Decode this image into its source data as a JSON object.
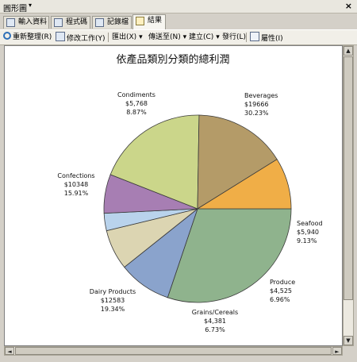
{
  "window": {
    "title": "圓形圖",
    "close_glyph": "×",
    "menu_glyph": "▾"
  },
  "tabs": [
    {
      "label": "輸入資料",
      "icon": "table-icon"
    },
    {
      "label": "程式碼",
      "icon": "code-icon"
    },
    {
      "label": "記錄檔",
      "icon": "log-icon"
    },
    {
      "label": "結果",
      "icon": "results-icon",
      "active": true
    }
  ],
  "toolbar": {
    "refresh": "重新整理(R)",
    "modify": "修改工作(Y)",
    "export": "匯出(X)",
    "send_to": "傳送至(N)",
    "create": "建立(C)",
    "publish": "發行(L)",
    "properties": "屬性(I)",
    "dropdown_glyph": "▾"
  },
  "chart_data": {
    "type": "pie",
    "title": "依產品類別分類的總利潤",
    "slices": [
      {
        "name": "Beverages",
        "amount": "$19666",
        "percent": "30.23%",
        "value": 30.23,
        "color": "#8fb38d"
      },
      {
        "name": "Seafood",
        "amount": "$5,940",
        "percent": "9.13%",
        "value": 9.13,
        "color": "#8aa3cc"
      },
      {
        "name": "Produce",
        "amount": "$4,525",
        "percent": "6.96%",
        "value": 6.96,
        "color": "#dcd5b2"
      },
      {
        "name": "",
        "amount": "",
        "percent": "",
        "value": 3.0,
        "color": "#b9d3ec"
      },
      {
        "name": "Grains/Cereals",
        "amount": "$4,381",
        "percent": "6.73%",
        "value": 6.73,
        "color": "#a77eb3"
      },
      {
        "name": "Dairy Products",
        "amount": "$12583",
        "percent": "19.34%",
        "value": 19.34,
        "color": "#cbd68a"
      },
      {
        "name": "Confections",
        "amount": "$10348",
        "percent": "15.91%",
        "value": 15.91,
        "color": "#b49b68"
      },
      {
        "name": "Condiments",
        "amount": "$5,768",
        "percent": "8.87%",
        "value": 8.87,
        "color": "#f0ae47"
      }
    ]
  },
  "scrollbar": {
    "up": "▲",
    "down": "▼",
    "left": "◄",
    "right": "►"
  }
}
